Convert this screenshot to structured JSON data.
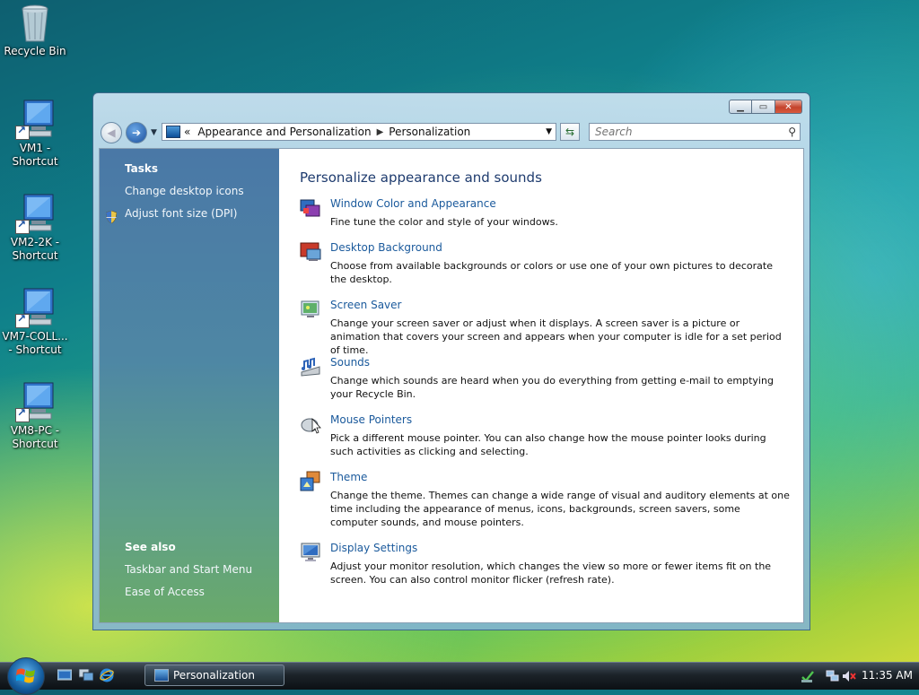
{
  "desktop": {
    "icons": [
      {
        "label": "Recycle Bin",
        "icon": "recycle-bin-icon"
      },
      {
        "label": "VM1 - Shortcut",
        "icon": "computer-icon"
      },
      {
        "label": "VM2-2K - Shortcut",
        "icon": "computer-icon"
      },
      {
        "label": "VM7-COLL... - Shortcut",
        "icon": "computer-icon"
      },
      {
        "label": "VM8-PC - Shortcut",
        "icon": "computer-icon"
      }
    ]
  },
  "window": {
    "controls": {
      "minimize": "minimize",
      "maximize": "maximize",
      "close": "close"
    },
    "address": {
      "prefix": "«",
      "crumbs": [
        "Appearance and Personalization",
        "Personalization"
      ]
    },
    "search": {
      "placeholder": "Search"
    }
  },
  "left_pane": {
    "tasks_heading": "Tasks",
    "tasks": [
      "Change desktop icons",
      "Adjust font size (DPI)"
    ],
    "see_also_heading": "See also",
    "see_also": [
      "Taskbar and Start Menu",
      "Ease of Access"
    ]
  },
  "main": {
    "title": "Personalize appearance and sounds",
    "items": [
      {
        "title": "Window Color and Appearance",
        "desc": "Fine tune the color and style of your windows.",
        "icon": "window-color-icon"
      },
      {
        "title": "Desktop Background",
        "desc": "Choose from available backgrounds or colors or use one of your own pictures to decorate the desktop.",
        "icon": "desktop-background-icon"
      },
      {
        "title": "Screen Saver",
        "desc": "Change your screen saver or adjust when it displays. A screen saver is a picture or animation that covers your screen and appears when your computer is idle for a set period of time.",
        "icon": "screen-saver-icon"
      },
      {
        "title": "Sounds",
        "desc": "Change which sounds are heard when you do everything from getting e-mail to emptying your Recycle Bin.",
        "icon": "sounds-icon"
      },
      {
        "title": "Mouse Pointers",
        "desc": "Pick a different mouse pointer. You can also change how the mouse pointer looks during such activities as clicking and selecting.",
        "icon": "mouse-icon"
      },
      {
        "title": "Theme",
        "desc": "Change the theme. Themes can change a wide range of visual and auditory elements at one time including the appearance of menus, icons, backgrounds, screen savers, some computer sounds, and mouse pointers.",
        "icon": "theme-icon"
      },
      {
        "title": "Display Settings",
        "desc": "Adjust your monitor resolution, which changes the view so more or fewer items fit on the screen. You can also control monitor flicker (refresh rate).",
        "icon": "display-settings-icon"
      }
    ]
  },
  "taskbar": {
    "active_window": "Personalization",
    "clock": "11:35 AM"
  }
}
